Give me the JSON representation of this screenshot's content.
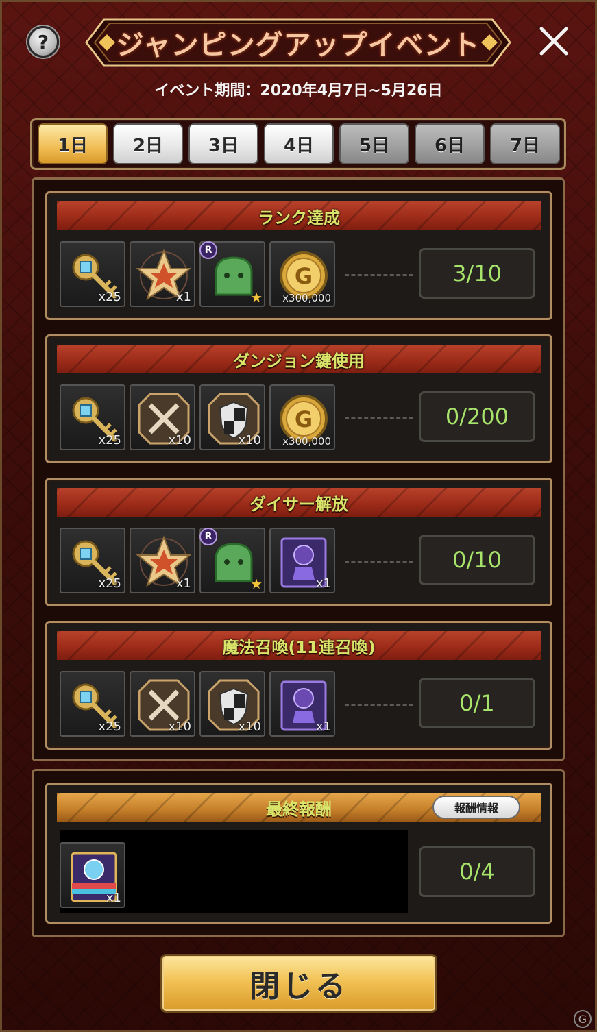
{
  "header": {
    "title": "ジャンピングアップイベント",
    "help_label": "?",
    "event_period": "イベント期間：2020年4月7日~5月26日"
  },
  "tabs": [
    {
      "label": "1日",
      "state": "active"
    },
    {
      "label": "2日",
      "state": "unlocked"
    },
    {
      "label": "3日",
      "state": "unlocked"
    },
    {
      "label": "4日",
      "state": "unlocked"
    },
    {
      "label": "5日",
      "state": "locked"
    },
    {
      "label": "6日",
      "state": "locked"
    },
    {
      "label": "7日",
      "state": "locked"
    }
  ],
  "missions": [
    {
      "title": "ランク達成",
      "progress": "3/10",
      "rewards": [
        {
          "icon": "key-icon",
          "qty": "x25"
        },
        {
          "icon": "star-icon",
          "qty": "x1"
        },
        {
          "icon": "green-slime-icon",
          "qty": "",
          "rank": "R"
        },
        {
          "icon": "gold-coin-icon",
          "qty": "x300,000"
        }
      ]
    },
    {
      "title": "ダンジョン鍵使用",
      "progress": "0/200",
      "rewards": [
        {
          "icon": "key-icon",
          "qty": "x25"
        },
        {
          "icon": "crossed-swords-icon",
          "qty": "x10"
        },
        {
          "icon": "shield-icon",
          "qty": "x10"
        },
        {
          "icon": "gold-coin-icon",
          "qty": "x300,000"
        }
      ]
    },
    {
      "title": "ダイサー解放",
      "progress": "0/10",
      "rewards": [
        {
          "icon": "key-icon",
          "qty": "x25"
        },
        {
          "icon": "star-icon",
          "qty": "x1"
        },
        {
          "icon": "green-slime-icon",
          "qty": "",
          "rank": "R"
        },
        {
          "icon": "purple-card-icon",
          "qty": "x1"
        }
      ]
    },
    {
      "title": "魔法召喚(11連召喚)",
      "progress": "0/1",
      "rewards": [
        {
          "icon": "key-icon",
          "qty": "x25"
        },
        {
          "icon": "crossed-swords-icon",
          "qty": "x10"
        },
        {
          "icon": "shield-icon",
          "qty": "x10"
        },
        {
          "icon": "purple-card-icon",
          "qty": "x1"
        }
      ]
    }
  ],
  "final": {
    "title": "最終報酬",
    "info_button": "報酬情報",
    "reward": {
      "icon": "rainbow-card-icon",
      "qty": "x1"
    },
    "progress": "0/4"
  },
  "close_button": "閉じる",
  "colors": {
    "accent_gold": "#f0bd55",
    "mission_bar": "#9a2a18",
    "progress_text": "#a7e36a"
  }
}
